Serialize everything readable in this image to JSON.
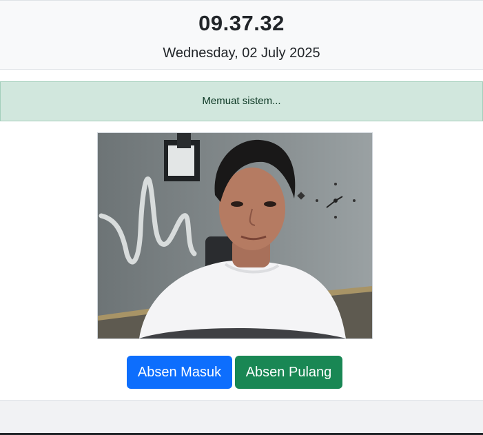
{
  "clock": {
    "time": "09.37.32",
    "date": "Wednesday, 02 July 2025"
  },
  "status": {
    "message": "Memuat sistem..."
  },
  "camera": {
    "icon": "webcam-feed"
  },
  "actions": {
    "check_in_label": "Absen Masuk",
    "check_out_label": "Absen Pulang"
  },
  "colors": {
    "primary": "#0d6efd",
    "success": "#198754",
    "alert_bg": "#d1e7dd",
    "alert_text": "#0a3622"
  }
}
